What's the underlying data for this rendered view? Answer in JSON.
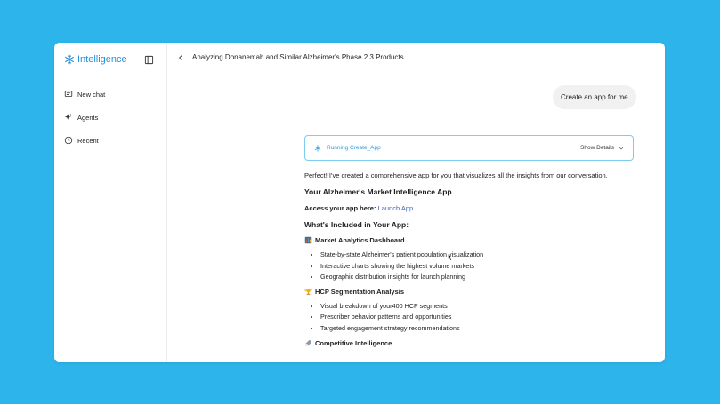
{
  "sidebar": {
    "brand": "Intelligence",
    "items": [
      {
        "label": "New chat",
        "icon": "chat-icon"
      },
      {
        "label": "Agents",
        "icon": "sparkle-icon"
      },
      {
        "label": "Recent",
        "icon": "clock-icon"
      }
    ]
  },
  "header": {
    "title": "Analyzing Donanemab and Similar Alzheimer's Phase 2 3 Products"
  },
  "chat": {
    "user_message": "Create an app for me",
    "status": {
      "text": "Running Create_App",
      "details_label": "Show Details"
    },
    "response": {
      "intro": "Perfect! I've created a comprehensive app for you that visualizes all the insights from our conversation.",
      "heading": "Your Alzheimer's Market Intelligence App",
      "access_label": "Access your app here:",
      "access_link": "Launch App",
      "included_heading": "What's Included in Your App:",
      "sections": [
        {
          "title": "Market Analytics Dashboard",
          "icon": "bar-chart-icon",
          "bullets": [
            "State-by-state Alzheimer's patient population visualization",
            "Interactive charts showing the highest volume markets",
            "Geographic distribution insights for launch planning"
          ]
        },
        {
          "title": "HCP Segmentation Analysis",
          "icon": "trophy-icon",
          "bullets": [
            "Visual breakdown of your400 HCP segments",
            "Prescriber behavior patterns and opportunities",
            "Targeted engagement strategy recommendations"
          ]
        },
        {
          "title": "Competitive Intelligence",
          "icon": "rocket-icon",
          "bullets": []
        }
      ]
    }
  },
  "colors": {
    "background": "#2db4ea",
    "brand": "#2a8fd6",
    "status_border": "#7ccdf0",
    "link": "#3c63b5",
    "badge": "#1fae5b"
  }
}
